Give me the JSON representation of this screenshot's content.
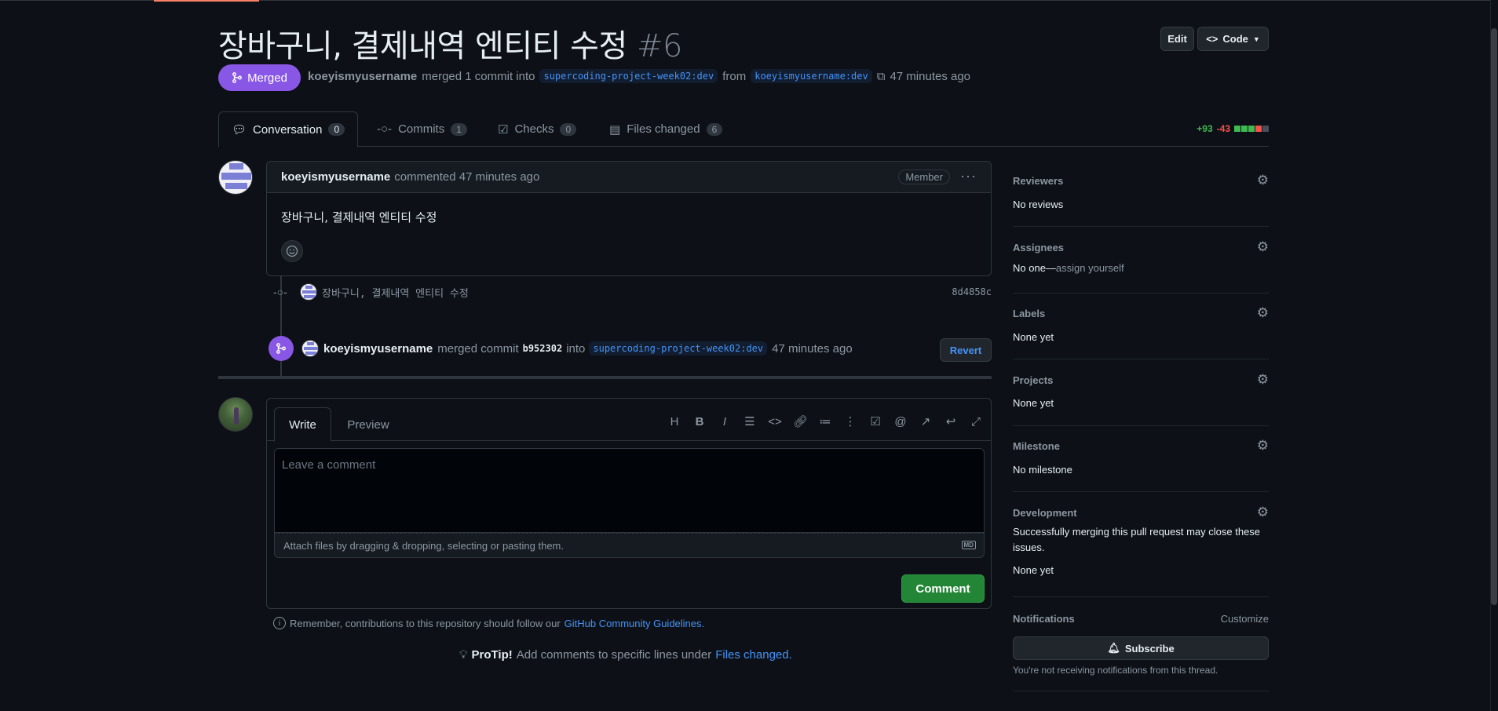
{
  "pr": {
    "title": "장바구니, 결제내역 엔티티 수정",
    "number": "#6",
    "status": "Merged",
    "author": "koeyismyusername",
    "meta_merged": "merged 1 commit into",
    "base_branch": "supercoding-project-week02:dev",
    "meta_from": "from",
    "head_branch": "koeyismyusername:dev",
    "time": "47 minutes ago"
  },
  "header_buttons": {
    "edit": "Edit",
    "code": "Code"
  },
  "tabs": [
    {
      "label": "Conversation",
      "count": "0"
    },
    {
      "label": "Commits",
      "count": "1"
    },
    {
      "label": "Checks",
      "count": "0"
    },
    {
      "label": "Files changed",
      "count": "6"
    }
  ],
  "diffstat": {
    "additions": "+93",
    "deletions": "-43"
  },
  "comment": {
    "author": "koeyismyusername",
    "action": "commented 47 minutes ago",
    "role": "Member",
    "body": "장바구니, 결제내역 엔티티 수정"
  },
  "commit": {
    "message": "장바구니, 결제내역 엔티티 수정",
    "sha": "8d4858c"
  },
  "merge_event": {
    "user": "koeyismyusername",
    "text1": "merged commit",
    "sha": "b952302",
    "text2": "into",
    "branch": "supercoding-project-week02:dev",
    "time": "47 minutes ago",
    "revert": "Revert"
  },
  "editor": {
    "tab_write": "Write",
    "tab_preview": "Preview",
    "placeholder": "Leave a comment",
    "attach": "Attach files by dragging & dropping, selecting or pasting them.",
    "md": "MD",
    "submit": "Comment"
  },
  "footer": {
    "remember": "Remember, contributions to this repository should follow our",
    "guidelines": "GitHub Community Guidelines",
    "protip_label": "ProTip!",
    "protip_text": "Add comments to specific lines under",
    "protip_link": "Files changed"
  },
  "sidebar": {
    "reviewers": {
      "title": "Reviewers",
      "value": "No reviews"
    },
    "assignees": {
      "title": "Assignees",
      "value": "No one—",
      "action": "assign yourself"
    },
    "labels": {
      "title": "Labels",
      "value": "None yet"
    },
    "projects": {
      "title": "Projects",
      "value": "None yet"
    },
    "milestone": {
      "title": "Milestone",
      "value": "No milestone"
    },
    "development": {
      "title": "Development",
      "note": "Successfully merging this pull request may close these issues.",
      "value": "None yet"
    },
    "notifications": {
      "title": "Notifications",
      "customize": "Customize",
      "subscribe": "Subscribe",
      "note": "You're not receiving notifications from this thread."
    }
  },
  "colors": {
    "merged": "#8957e5",
    "link": "#4493f8",
    "add": "#3fb950",
    "del": "#f85149",
    "primary_button": "#238636"
  }
}
